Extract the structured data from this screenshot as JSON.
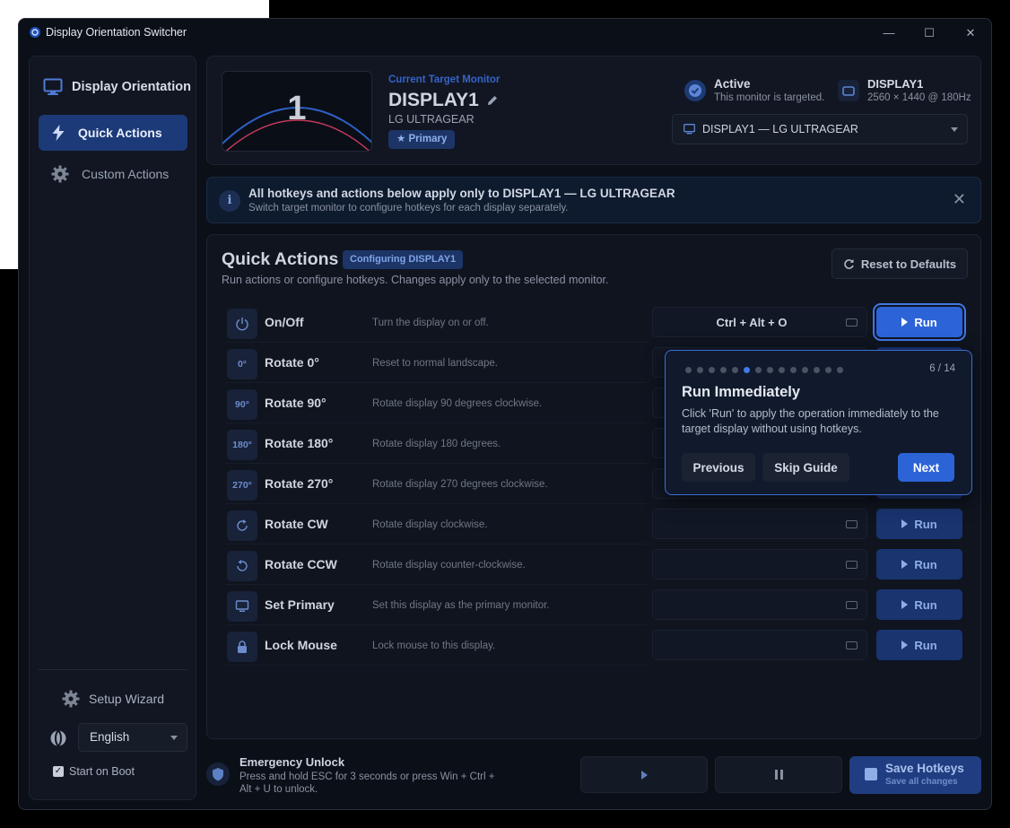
{
  "window": {
    "title": "Display Orientation Switcher"
  },
  "sidebar": {
    "brand": "Display Orientation",
    "items": [
      {
        "label": "Quick Actions",
        "active": true
      },
      {
        "label": "Custom Actions",
        "active": false
      }
    ],
    "setup_wizard": "Setup Wizard",
    "language": "English",
    "start_on_boot": "Start on Boot",
    "start_on_boot_checked": true
  },
  "monitor": {
    "thumb_number": "1",
    "current_label": "Current Target Monitor",
    "name": "DISPLAY1",
    "model": "LG ULTRAGEAR",
    "primary_badge": "Primary",
    "status_title": "Active",
    "status_sub": "This monitor is targeted.",
    "display_title": "DISPLAY1",
    "display_sub": "2560 × 1440 @ 180Hz",
    "selected": "DISPLAY1 — LG ULTRAGEAR"
  },
  "banner": {
    "title": "All hotkeys and actions below apply only to DISPLAY1 — LG ULTRAGEAR",
    "subtitle": "Switch target monitor to configure hotkeys for each display separately."
  },
  "quick_actions": {
    "title": "Quick Actions",
    "badge": "Configuring DISPLAY1",
    "subtitle": "Run actions or configure hotkeys. Changes apply only to the selected monitor.",
    "reset_label": "Reset to Defaults",
    "run_label": "Run",
    "rows": [
      {
        "icon": "power-icon",
        "icon_text": "",
        "name": "On/Off",
        "desc": "Turn the display on or off.",
        "hotkey": "Ctrl + Alt + O"
      },
      {
        "icon": "rotate-0-icon",
        "icon_text": "0°",
        "name": "Rotate 0°",
        "desc": "Reset to normal landscape.",
        "hotkey": ""
      },
      {
        "icon": "rotate-90-icon",
        "icon_text": "90°",
        "name": "Rotate 90°",
        "desc": "Rotate display 90 degrees clockwise.",
        "hotkey": ""
      },
      {
        "icon": "rotate-180-icon",
        "icon_text": "180°",
        "name": "Rotate 180°",
        "desc": "Rotate display 180 degrees.",
        "hotkey": ""
      },
      {
        "icon": "rotate-270-icon",
        "icon_text": "270°",
        "name": "Rotate 270°",
        "desc": "Rotate display 270 degrees clockwise.",
        "hotkey": ""
      },
      {
        "icon": "rotate-cw-icon",
        "icon_text": "",
        "name": "Rotate CW",
        "desc": "Rotate display clockwise.",
        "hotkey": ""
      },
      {
        "icon": "rotate-ccw-icon",
        "icon_text": "",
        "name": "Rotate CCW",
        "desc": "Rotate display counter-clockwise.",
        "hotkey": ""
      },
      {
        "icon": "monitor-icon",
        "icon_text": "",
        "name": "Set Primary",
        "desc": "Set this display as the primary monitor.",
        "hotkey": ""
      },
      {
        "icon": "lock-icon",
        "icon_text": "",
        "name": "Lock Mouse",
        "desc": "Lock mouse to this display.",
        "hotkey": ""
      }
    ]
  },
  "guide": {
    "step": "6 / 14",
    "step_current": 6,
    "step_total": 14,
    "title": "Run Immediately",
    "body": "Click 'Run' to apply the operation immediately to the target display without using hotkeys.",
    "previous": "Previous",
    "skip": "Skip Guide",
    "next": "Next"
  },
  "bottom": {
    "emergency_title": "Emergency Unlock",
    "emergency_sub": "Press and hold ESC for 3 seconds or press Win + Ctrl + Alt + U to unlock.",
    "save_title": "Save Hotkeys",
    "save_sub": "Save all changes"
  },
  "colors": {
    "accent": "#2c64d8",
    "background": "#0b0f17",
    "panel": "#111622"
  }
}
